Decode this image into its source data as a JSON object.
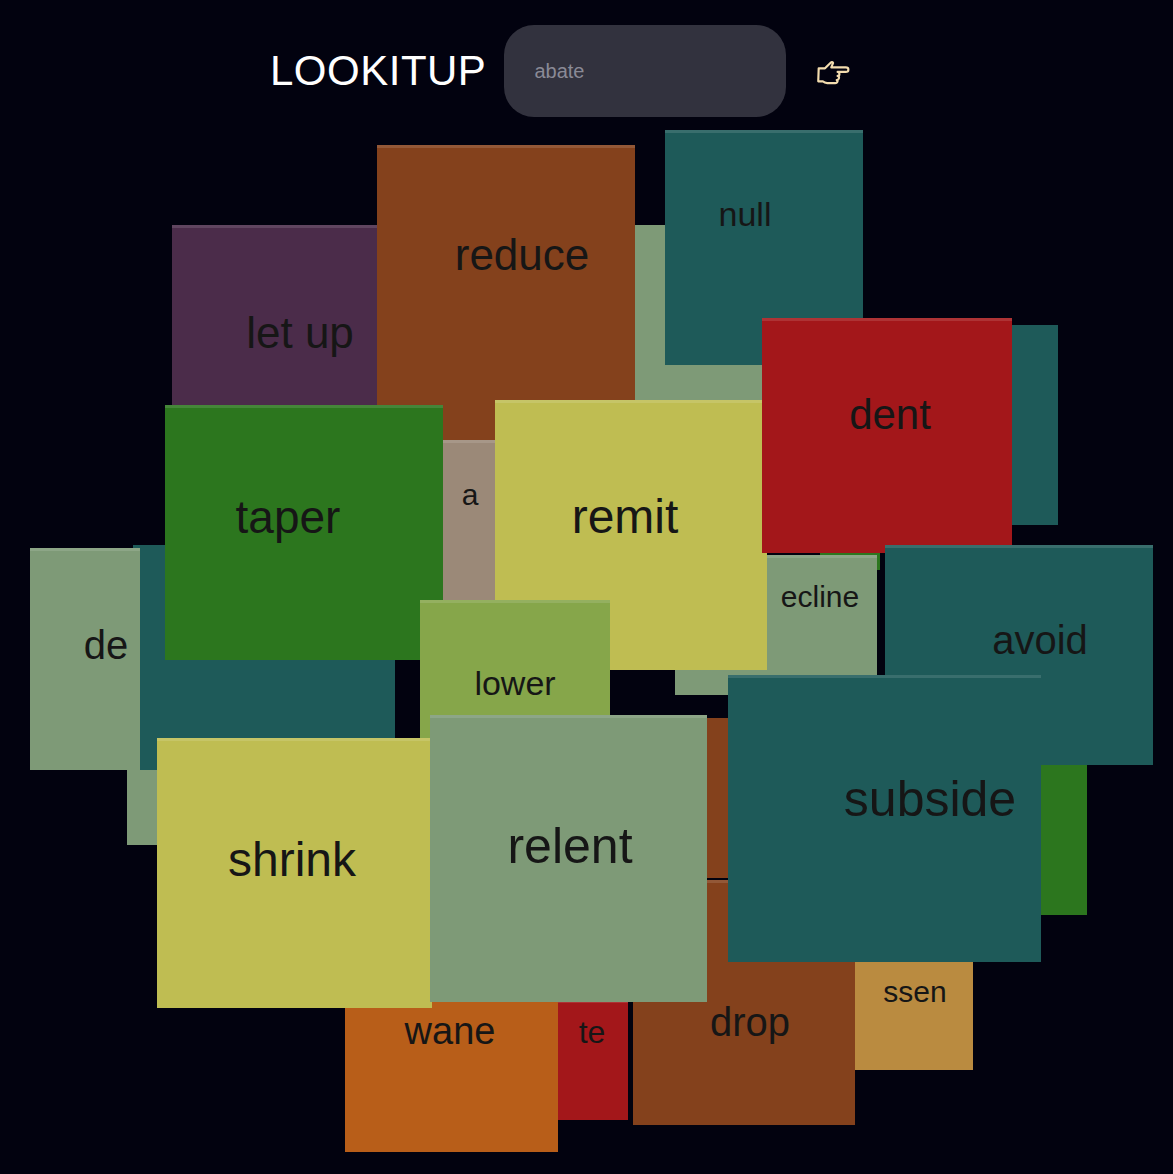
{
  "header": {
    "title": "LOOKITUP",
    "search": {
      "placeholder": "abate"
    }
  },
  "cubes": [
    {
      "label": "let up",
      "color": "#4b2c4a"
    },
    {
      "label": "reduce",
      "color": "#84411c"
    },
    {
      "label": "null",
      "color": "#1e5a59"
    },
    {
      "label": "a",
      "color": "#9b8978"
    },
    {
      "label": "taper",
      "color": "#2c761e"
    },
    {
      "label": "remit",
      "color": "#bfbd52"
    },
    {
      "label": "dent",
      "color": "#a3171a"
    },
    {
      "label": "de",
      "color": "#7e9a77"
    },
    {
      "label": "lower",
      "color": "#86a64a"
    },
    {
      "label": "ecline",
      "color": "#7e9a77"
    },
    {
      "label": "avoid",
      "color": "#1e5a59"
    },
    {
      "label": "wane",
      "color": "#b85e19"
    },
    {
      "label": "te",
      "color": "#a3171a"
    },
    {
      "label": "drop",
      "color": "#84411c"
    },
    {
      "label": "ssen",
      "color": "#ba8b40"
    },
    {
      "label": "shrink",
      "color": "#bfbd52"
    },
    {
      "label": "relent",
      "color": "#7e9a77"
    },
    {
      "label": "subside",
      "color": "#1e5a59"
    }
  ]
}
